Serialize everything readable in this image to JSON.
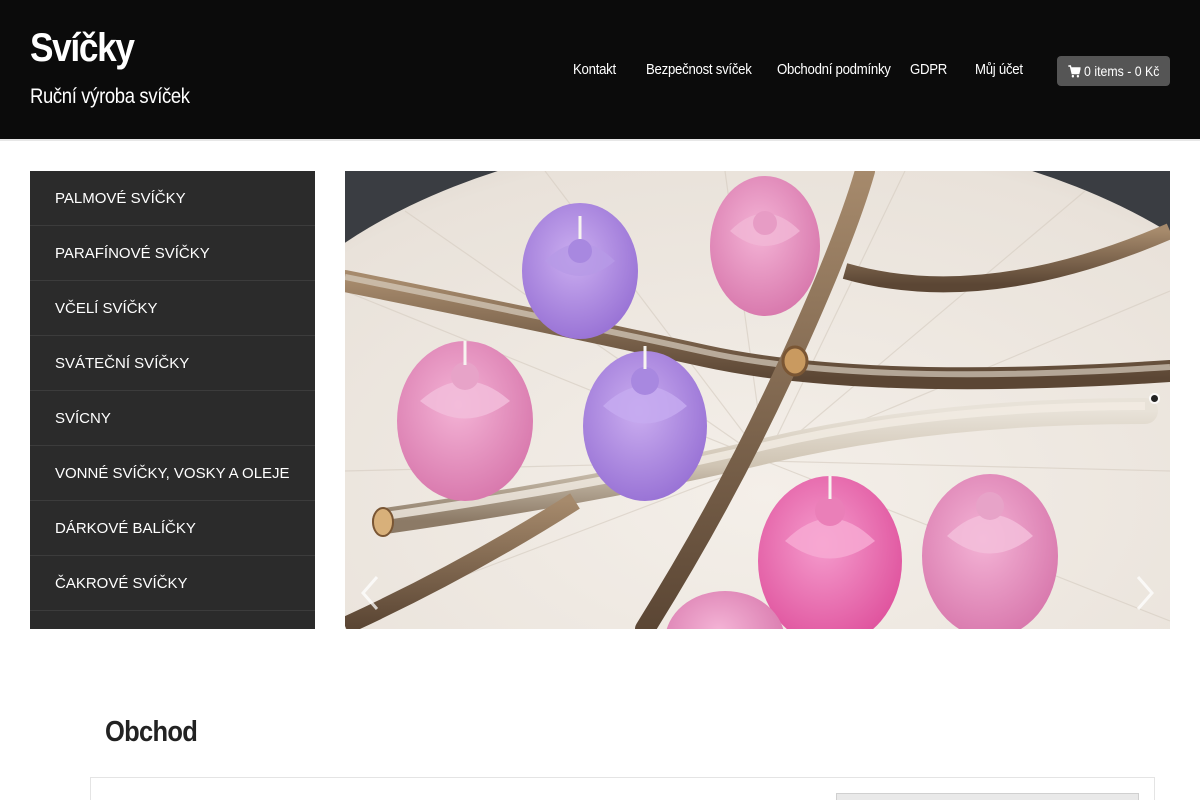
{
  "header": {
    "title": "Svíčky",
    "tagline": "Ruční výroba svíček"
  },
  "nav": {
    "items": [
      {
        "label": "Kontakt"
      },
      {
        "label": "Bezpečnost svíček"
      },
      {
        "label": "Obchodní podmínky"
      },
      {
        "label": "GDPR"
      },
      {
        "label": "Můj účet"
      }
    ]
  },
  "cart": {
    "label": "0 items - 0 Kč",
    "icon": "shopping-cart-icon"
  },
  "sidebar": {
    "items": [
      {
        "label": "PALMOVÉ SVÍČKY"
      },
      {
        "label": "PARAFÍNOVÉ SVÍČKY"
      },
      {
        "label": "VČELÍ SVÍČKY"
      },
      {
        "label": "SVÁTEČNÍ SVÍČKY"
      },
      {
        "label": "SVÍCNY"
      },
      {
        "label": "VONNÉ SVÍČKY, VOSKY A OLEJE"
      },
      {
        "label": "DÁRKOVÉ BALÍČKY"
      },
      {
        "label": "ČAKROVÉ SVÍČKY"
      }
    ]
  },
  "slider": {
    "prev_icon": "chevron-left-icon",
    "next_icon": "chevron-right-icon",
    "slide_count": 1,
    "active_slide": 1
  },
  "shop": {
    "heading": "Obchod"
  },
  "colors": {
    "header_bg": "#0b0b0b",
    "sidebar_bg": "#2b2b2b",
    "cart_bg": "#555555",
    "pink_candle": "#e58fc0",
    "purple_candle": "#b28be0"
  }
}
